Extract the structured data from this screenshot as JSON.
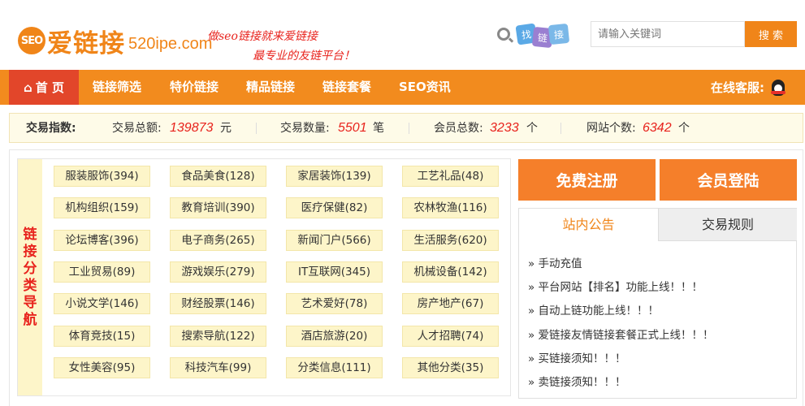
{
  "header": {
    "logo_badge": "SEO",
    "logo_text": "爱链接",
    "logo_domain": "520ipe.com",
    "slogan_line1": "做seo链接就来爱链接",
    "slogan_line2": "最专业的友链平台！",
    "findlink_tiles": [
      "找",
      "链",
      "接"
    ],
    "search_placeholder": "请输入关键词",
    "search_button": "搜 索"
  },
  "nav": {
    "home": "首 页",
    "items": [
      "链接筛选",
      "特价链接",
      "精品链接",
      "链接套餐",
      "SEO资讯"
    ],
    "service_label": "在线客服:"
  },
  "stats": {
    "title": "交易指数:",
    "total_amount_label": "交易总额:",
    "total_amount": "139873",
    "total_amount_unit": "元",
    "trade_count_label": "交易数量:",
    "trade_count": "5501",
    "trade_count_unit": "笔",
    "members_label": "会员总数:",
    "members": "3233",
    "members_unit": "个",
    "sites_label": "网站个数:",
    "sites": "6342",
    "sites_unit": "个"
  },
  "categories": {
    "label_chars": [
      "链",
      "接",
      "分",
      "类",
      "导",
      "航"
    ],
    "items": [
      "服装服饰(394)",
      "食品美食(128)",
      "家居装饰(139)",
      "工艺礼品(48)",
      "机构组织(159)",
      "教育培训(390)",
      "医疗保健(82)",
      "农林牧渔(116)",
      "论坛博客(396)",
      "电子商务(265)",
      "新闻门户(566)",
      "生活服务(620)",
      "工业贸易(89)",
      "游戏娱乐(279)",
      "IT互联网(345)",
      "机械设备(142)",
      "小说文学(146)",
      "财经股票(146)",
      "艺术爱好(78)",
      "房产地产(67)",
      "体育竞技(15)",
      "搜索导航(122)",
      "酒店旅游(20)",
      "人才招聘(74)",
      "女性美容(95)",
      "科技汽车(99)",
      "分类信息(111)",
      "其他分类(35)"
    ]
  },
  "sidebar": {
    "register": "免费注册",
    "login": "会员登陆",
    "tab_notice": "站内公告",
    "tab_rules": "交易规则",
    "notices": [
      "» 手动充值",
      "» 平台网站【排名】功能上线！！！",
      "» 自动上链功能上线！！！",
      "» 爱链接友情链接套餐正式上线！！！",
      "» 买链接须知！！！",
      "» 卖链接须知！！！"
    ]
  },
  "colors": {
    "brand_orange": "#f08519",
    "nav_bg": "#f28b1e",
    "home_active": "#e2462a",
    "highlight_red": "#e8231d",
    "category_bg": "#fdf5c9"
  }
}
